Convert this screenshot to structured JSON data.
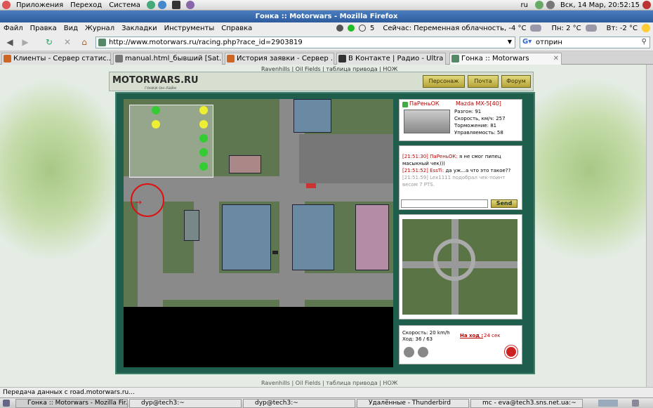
{
  "top_panel": {
    "menus": [
      "Приложения",
      "Переход",
      "Система"
    ],
    "lang": "ru",
    "clock": "Вск, 14 Мар, 20:52:15"
  },
  "window": {
    "title": "Гонка :: Motorwars - Mozilla Firefox"
  },
  "menubar": {
    "items": [
      "Файл",
      "Правка",
      "Вид",
      "Журнал",
      "Закладки",
      "Инструменты",
      "Справка"
    ],
    "counter": "5",
    "weather_now": "Сейчас: Переменная облачность, -4 °C",
    "weather_mon": "Пн: 2 °C",
    "weather_tue": "Вт: -2 °C"
  },
  "nav": {
    "url": "http://www.motorwars.ru/racing.php?race_id=2903819",
    "search": "отприн"
  },
  "tabs": [
    {
      "label": "Клиенты - Сервер статис..."
    },
    {
      "label": "manual.html_бывший [Sat..."
    },
    {
      "label": "История заявки - Сервер ..."
    },
    {
      "label": "В Контакте | Радио - Ultra"
    },
    {
      "label": "Гонка :: Motorwars"
    }
  ],
  "site": {
    "logo": "MOTORWARS.RU",
    "logo_sub": "гонки он-лайн",
    "nav_links": "Ravenhills | Oil Fields | таблица привода | НОЖ",
    "buttons": {
      "persona": "Персонаж",
      "mail": "Почта",
      "forum": "Форум"
    },
    "footer_links": "Ravenhills | Oil Fields | таблица привода | НОЖ"
  },
  "player": {
    "name": "ПаРеньОК",
    "car": "Mazda MX-5[40]",
    "stats": [
      "Разгон: 91",
      "Скорость, км/ч: 257",
      "Торможение: 81",
      "Управляемость: 58"
    ]
  },
  "chat": {
    "messages": [
      {
        "time": "[21:51:30]",
        "nick": "ПаРеньОК:",
        "text": "я не смог пипец масыкный чек)))"
      },
      {
        "time": "[21:51:52]",
        "nick": "EssTi:",
        "text": "да уж...а что это такое??"
      },
      {
        "time": "[21:51:59]",
        "nick": "",
        "text": "Lex1111 подобрал чек-поинт весом 7 PTS."
      }
    ],
    "send_label": "Send"
  },
  "race": {
    "speed": "Скорость: 20 km/h",
    "move": "Ход: 36 / 63",
    "turn_label": "На ход :",
    "turn_time": "24 сек"
  },
  "statusbar": {
    "text": "Передача данных с road.motorwars.ru..."
  },
  "taskbar": [
    {
      "label": "Гонка :: Motorwars - Mozilla Fir..."
    },
    {
      "label": "dyp@tech3:~"
    },
    {
      "label": "dyp@tech3:~"
    },
    {
      "label": "Удалённые - Thunderbird"
    },
    {
      "label": "mc - eva@tech3.sns.net.ua:~"
    }
  ]
}
